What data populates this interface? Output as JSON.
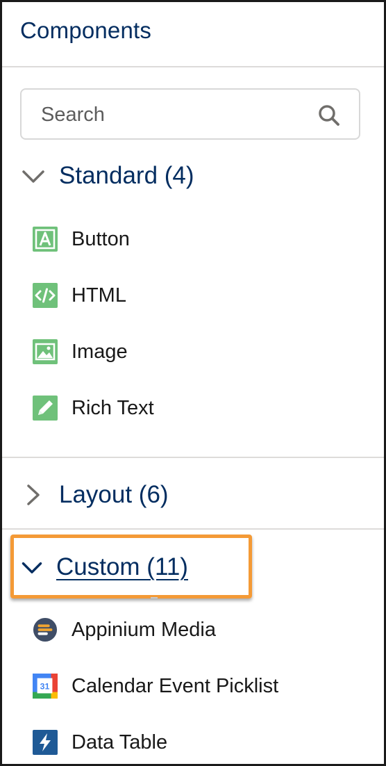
{
  "panel": {
    "title": "Components"
  },
  "search": {
    "placeholder": "Search"
  },
  "sections": {
    "standard": {
      "label": "Standard (4)",
      "expanded": true,
      "items": [
        {
          "label": "Button",
          "icon": "button-icon"
        },
        {
          "label": "HTML",
          "icon": "html-code-icon"
        },
        {
          "label": "Image",
          "icon": "image-icon"
        },
        {
          "label": "Rich Text",
          "icon": "pencil-icon"
        }
      ]
    },
    "layout": {
      "label": "Layout (6)",
      "expanded": false
    },
    "custom": {
      "label": "Custom (11)",
      "expanded": true,
      "items": [
        {
          "label": "Appinium Media",
          "icon": "appinium-icon"
        },
        {
          "label": "Calendar Event Picklist",
          "icon": "calendar-icon"
        },
        {
          "label": "Data Table",
          "icon": "lightning-icon"
        }
      ]
    }
  },
  "colors": {
    "heading": "#032d60",
    "standard_icon_green": "#6fc17a",
    "highlight_orange": "#f49a36",
    "divider": "#dddbda"
  }
}
